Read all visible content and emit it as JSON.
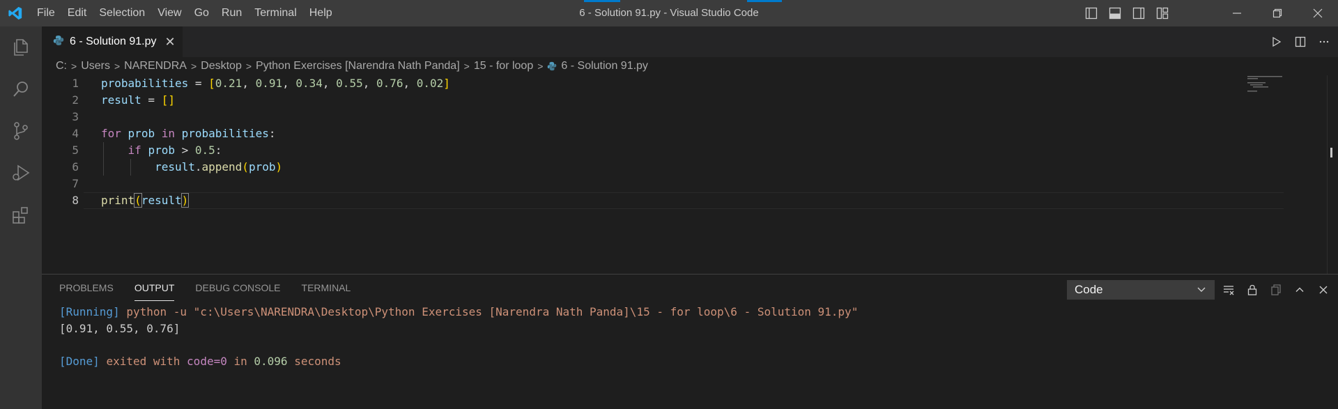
{
  "window": {
    "title": "6 - Solution 91.py - Visual Studio Code",
    "accent_color": "#007acc"
  },
  "menu": [
    "File",
    "Edit",
    "Selection",
    "View",
    "Go",
    "Run",
    "Terminal",
    "Help"
  ],
  "activity_bar": {
    "items": [
      "explorer-icon",
      "search-icon",
      "source-control-icon",
      "run-debug-icon",
      "extensions-icon"
    ]
  },
  "tab": {
    "label": "6 - Solution 91.py",
    "close_glyph": "✕"
  },
  "editor_actions": [
    "run-icon",
    "split-editor-icon",
    "more-actions-icon"
  ],
  "breadcrumb": [
    "C:",
    "Users",
    "NARENDRA",
    "Desktop",
    "Python Exercises [Narendra Nath Panda]",
    "15 - for loop",
    "6 - Solution 91.py"
  ],
  "editor": {
    "current_line": 8,
    "lines": [
      {
        "n": "1",
        "text": "probabilities = [0.21, 0.91, 0.34, 0.55, 0.76, 0.02]"
      },
      {
        "n": "2",
        "text": "result = []"
      },
      {
        "n": "3",
        "text": ""
      },
      {
        "n": "4",
        "text": "for prob in probabilities:"
      },
      {
        "n": "5",
        "text": "    if prob > 0.5:"
      },
      {
        "n": "6",
        "text": "        result.append(prob)"
      },
      {
        "n": "7",
        "text": ""
      },
      {
        "n": "8",
        "text": "print(result)"
      }
    ]
  },
  "panel": {
    "tabs": [
      "PROBLEMS",
      "OUTPUT",
      "DEBUG CONSOLE",
      "TERMINAL"
    ],
    "active_tab": "OUTPUT",
    "output_channel": "Code",
    "output_lines": [
      "[Running] python -u \"c:\\Users\\NARENDRA\\Desktop\\Python Exercises [Narendra Nath Panda]\\15 - for loop\\6 - Solution 91.py\"",
      "[0.91, 0.55, 0.76]",
      "",
      "[Done] exited with code=0 in 0.096 seconds"
    ]
  }
}
